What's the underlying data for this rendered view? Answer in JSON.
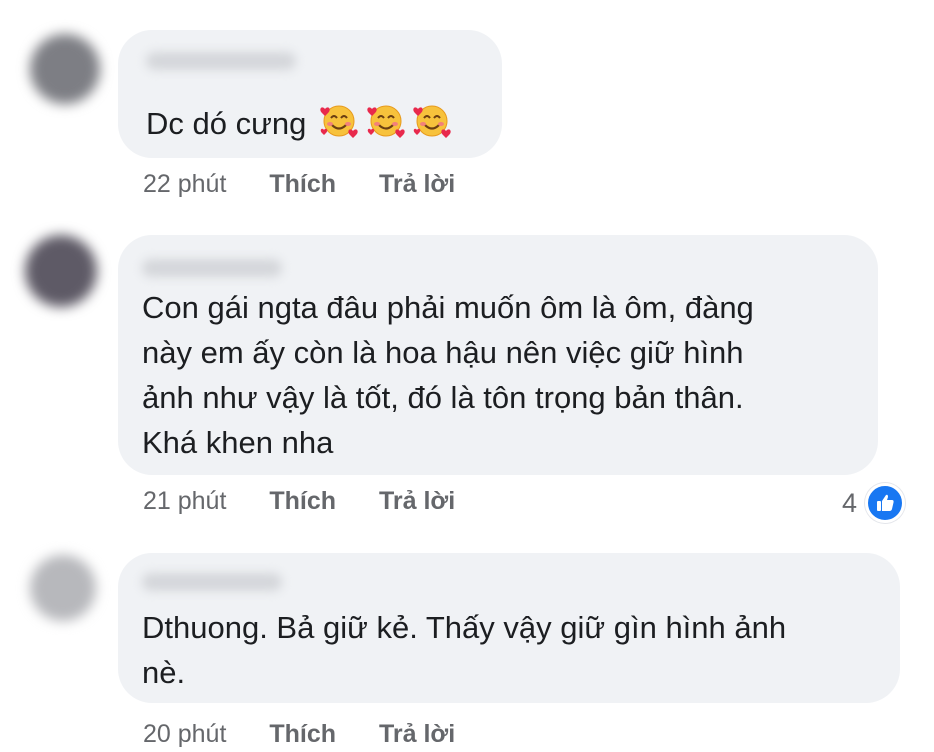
{
  "comments": [
    {
      "text_lines": [
        "Dc dó cưng"
      ],
      "emoji": "smiling-face-with-hearts-icon",
      "time": "22 phút",
      "like_label": "Thích",
      "reply_label": "Trả lời"
    },
    {
      "text_lines": [
        "Con gái ngta đâu phải muốn ôm là ôm, đàng",
        "này em ấy còn là hoa hậu nên việc giữ hình",
        "ảnh như vậy là tốt, đó là tôn trọng bản thân.",
        "Khá khen nha"
      ],
      "time": "21 phút",
      "like_label": "Thích",
      "reply_label": "Trả lời",
      "reaction_count": "4",
      "reaction_icon": "like-icon"
    },
    {
      "text_lines": [
        "Dthuong. Bả giữ kẻ. Thấy vậy giữ gìn hình ảnh",
        "nè."
      ],
      "time": "20 phút",
      "like_label": "Thích",
      "reply_label": "Trả lời"
    }
  ],
  "colors": {
    "bubble": "#f0f2f5",
    "text": "#1c1e21",
    "meta": "#65676b",
    "like_badge": "#1877f2"
  }
}
